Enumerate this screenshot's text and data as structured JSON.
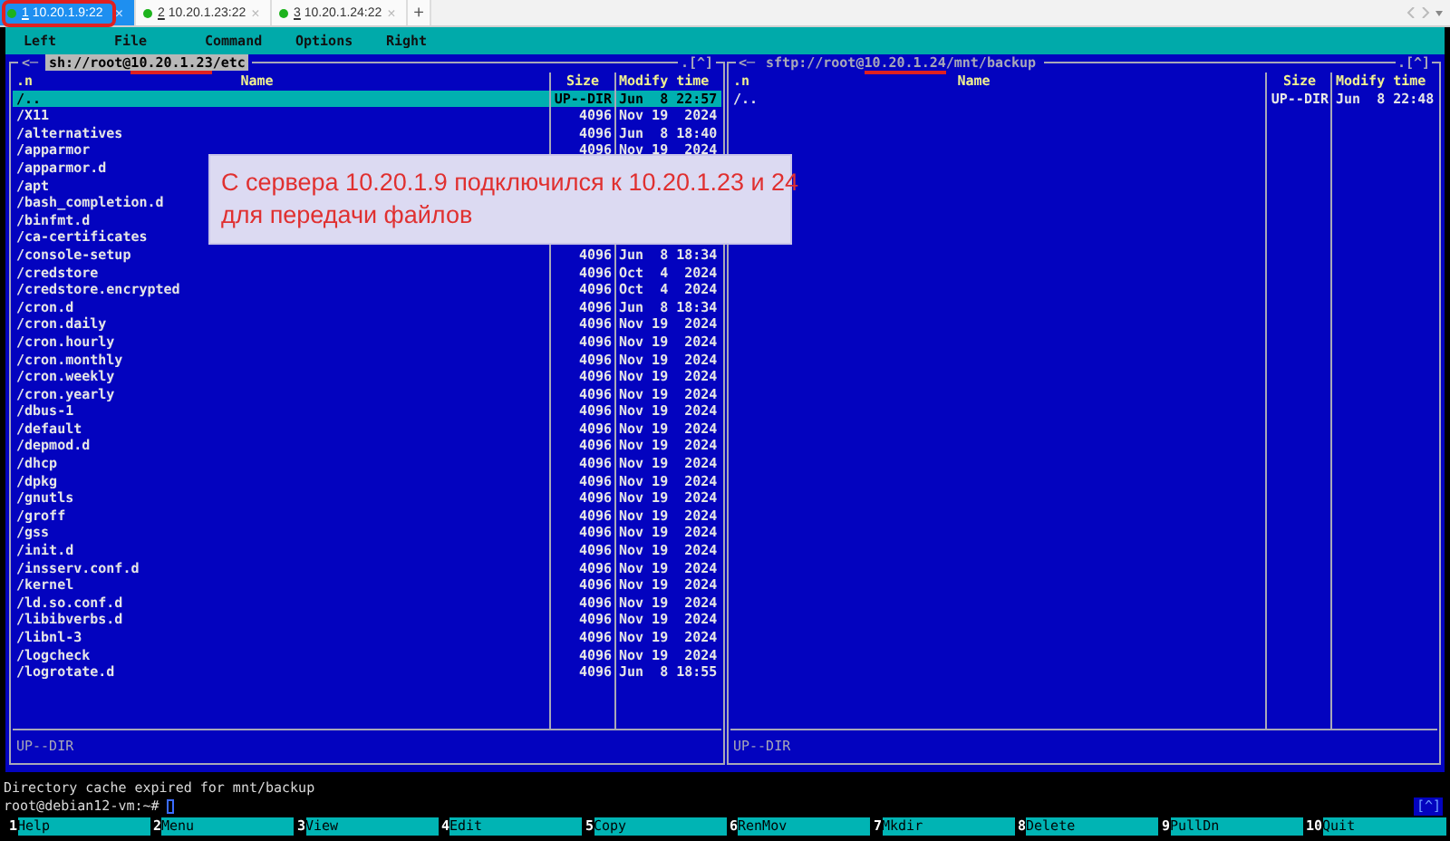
{
  "tabs": [
    {
      "number": "1",
      "label": "10.20.1.9:22",
      "selected": true,
      "close": "×"
    },
    {
      "number": "2",
      "label": "10.20.1.23:22",
      "selected": false,
      "close": "×"
    },
    {
      "number": "3",
      "label": "10.20.1.24:22",
      "selected": false,
      "close": "×"
    }
  ],
  "new_tab": "+",
  "menu": [
    "Left",
    "File",
    "Command",
    "Options",
    "Right"
  ],
  "left_panel": {
    "history_button": "<─",
    "path": "sh://root@10.20.1.23/etc",
    "active": true,
    "corner": ".[^]",
    "columns": [
      ".n",
      "Name",
      "Size",
      "Modify time"
    ],
    "rows": [
      {
        "name": "/..",
        "size": "UP--DIR",
        "time": "Jun  8 22:57",
        "selected": true
      },
      {
        "name": "/X11",
        "size": "4096",
        "time": "Nov 19  2024",
        "selected": false
      },
      {
        "name": "/alternatives",
        "size": "4096",
        "time": "Jun  8 18:40",
        "selected": false
      },
      {
        "name": "/apparmor",
        "size": "4096",
        "time": "Nov 19  2024",
        "selected": false
      },
      {
        "name": "/apparmor.d",
        "selected": false
      },
      {
        "name": "/apt",
        "selected": false
      },
      {
        "name": "/bash_completion.d",
        "selected": false
      },
      {
        "name": "/binfmt.d",
        "selected": false
      },
      {
        "name": "/ca-certificates",
        "selected": false
      },
      {
        "name": "/console-setup",
        "size": "4096",
        "time": "Jun  8 18:34",
        "selected": false
      },
      {
        "name": "/credstore",
        "size": "4096",
        "time": "Oct  4  2024",
        "selected": false
      },
      {
        "name": "/credstore.encrypted",
        "size": "4096",
        "time": "Oct  4  2024",
        "selected": false
      },
      {
        "name": "/cron.d",
        "size": "4096",
        "time": "Jun  8 18:34",
        "selected": false
      },
      {
        "name": "/cron.daily",
        "size": "4096",
        "time": "Nov 19  2024",
        "selected": false
      },
      {
        "name": "/cron.hourly",
        "size": "4096",
        "time": "Nov 19  2024",
        "selected": false
      },
      {
        "name": "/cron.monthly",
        "size": "4096",
        "time": "Nov 19  2024",
        "selected": false
      },
      {
        "name": "/cron.weekly",
        "size": "4096",
        "time": "Nov 19  2024",
        "selected": false
      },
      {
        "name": "/cron.yearly",
        "size": "4096",
        "time": "Nov 19  2024",
        "selected": false
      },
      {
        "name": "/dbus-1",
        "size": "4096",
        "time": "Nov 19  2024",
        "selected": false
      },
      {
        "name": "/default",
        "size": "4096",
        "time": "Nov 19  2024",
        "selected": false
      },
      {
        "name": "/depmod.d",
        "size": "4096",
        "time": "Nov 19  2024",
        "selected": false
      },
      {
        "name": "/dhcp",
        "size": "4096",
        "time": "Nov 19  2024",
        "selected": false
      },
      {
        "name": "/dpkg",
        "size": "4096",
        "time": "Nov 19  2024",
        "selected": false
      },
      {
        "name": "/gnutls",
        "size": "4096",
        "time": "Nov 19  2024",
        "selected": false
      },
      {
        "name": "/groff",
        "size": "4096",
        "time": "Nov 19  2024",
        "selected": false
      },
      {
        "name": "/gss",
        "size": "4096",
        "time": "Nov 19  2024",
        "selected": false
      },
      {
        "name": "/init.d",
        "size": "4096",
        "time": "Nov 19  2024",
        "selected": false
      },
      {
        "name": "/insserv.conf.d",
        "size": "4096",
        "time": "Nov 19  2024",
        "selected": false
      },
      {
        "name": "/kernel",
        "size": "4096",
        "time": "Nov 19  2024",
        "selected": false
      },
      {
        "name": "/ld.so.conf.d",
        "size": "4096",
        "time": "Nov 19  2024",
        "selected": false
      },
      {
        "name": "/libibverbs.d",
        "size": "4096",
        "time": "Nov 19  2024",
        "selected": false
      },
      {
        "name": "/libnl-3",
        "size": "4096",
        "time": "Nov 19  2024",
        "selected": false
      },
      {
        "name": "/logcheck",
        "size": "4096",
        "time": "Nov 19  2024",
        "selected": false
      },
      {
        "name": "/logrotate.d",
        "size": "4096",
        "time": "Jun  8 18:55",
        "selected": false
      }
    ],
    "status": "UP--DIR"
  },
  "right_panel": {
    "history_button": "<─",
    "path": "sftp://root@10.20.1.24/mnt/backup",
    "active": false,
    "corner": ".[^]",
    "columns": [
      ".n",
      "Name",
      "Size",
      "Modify time"
    ],
    "rows": [
      {
        "name": "/..",
        "size": "UP--DIR",
        "time": "Jun  8 22:48",
        "selected": false
      }
    ],
    "status": "UP--DIR"
  },
  "note": "С сервера 10.20.1.9 подключился к 10.20.1.23 и 24\nдля передачи файлов",
  "message": "Directory cache expired for mnt/backup",
  "prompt": "root@debian12-vm:~#",
  "scroll_marker": "[^]",
  "function_keys": [
    {
      "key": "1",
      "label": "Help"
    },
    {
      "key": "2",
      "label": "Menu"
    },
    {
      "key": "3",
      "label": "View"
    },
    {
      "key": "4",
      "label": "Edit"
    },
    {
      "key": "5",
      "label": "Copy"
    },
    {
      "key": "6",
      "label": "RenMov"
    },
    {
      "key": "7",
      "label": "Mkdir"
    },
    {
      "key": "8",
      "label": "Delete"
    },
    {
      "key": "9",
      "label": "PullDn"
    },
    {
      "key": "10",
      "label": "Quit"
    }
  ]
}
